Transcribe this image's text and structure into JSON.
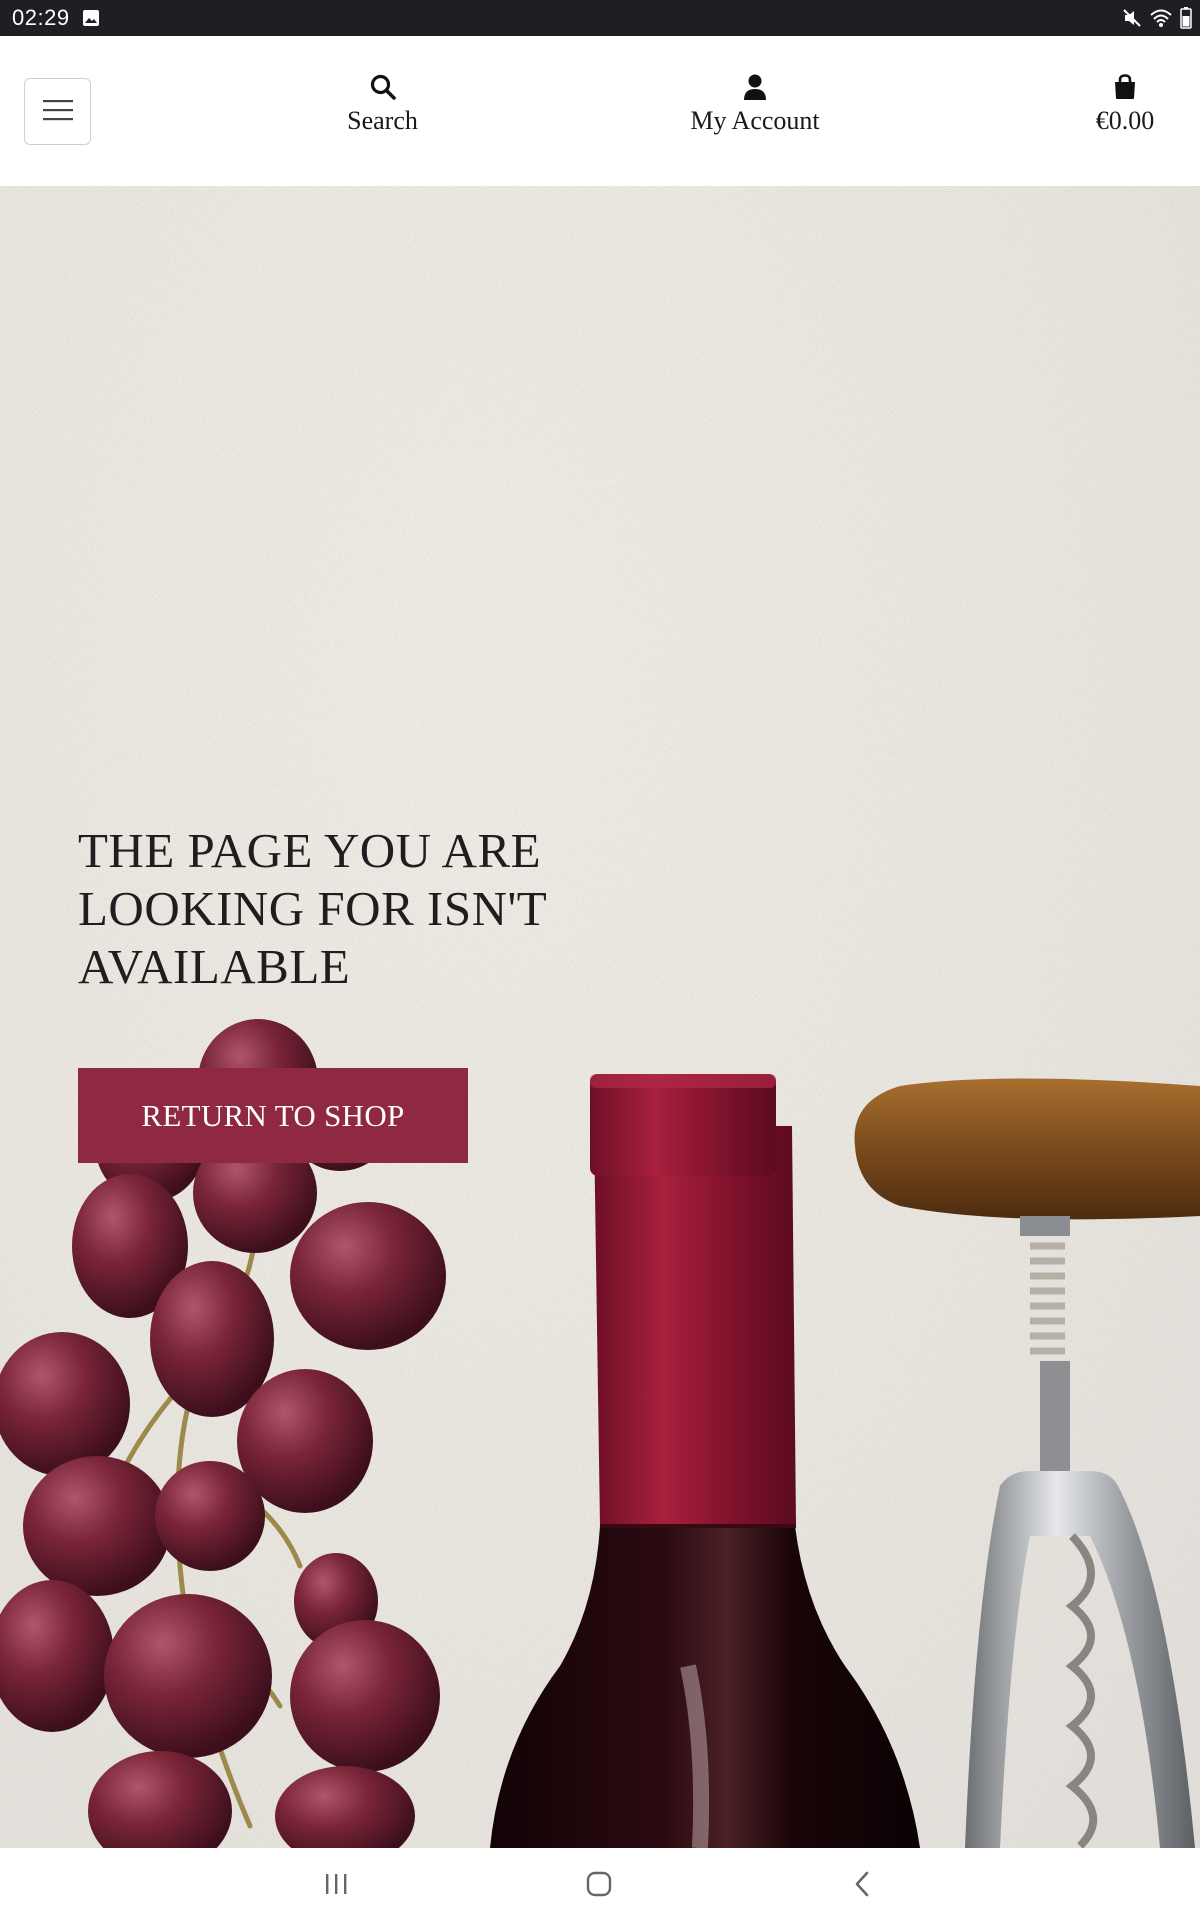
{
  "status_bar": {
    "time": "02:29",
    "icons": [
      "image-icon",
      "mute-icon",
      "wifi-icon",
      "battery-icon"
    ]
  },
  "header": {
    "menu_icon": "hamburger-icon",
    "search_label": "Search",
    "account_label": "My Account",
    "cart_total": "€0.00"
  },
  "hero": {
    "message": "THE PAGE YOU ARE LOOKING FOR ISN'T AVAILABLE",
    "button_label": "RETURN TO SHOP"
  },
  "colors": {
    "accent": "#8e2941",
    "status_bar_bg": "#1d1f24",
    "background": "#ece8e2"
  },
  "android_nav": {
    "icons": [
      "recent-apps-icon",
      "home-icon",
      "back-icon"
    ]
  }
}
